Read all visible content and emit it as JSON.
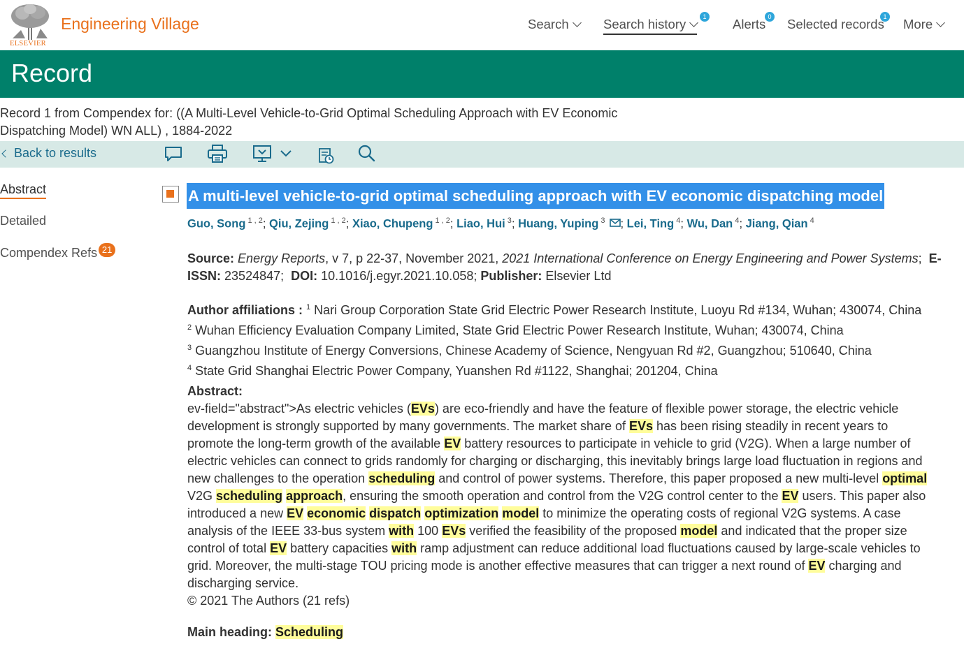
{
  "nav": {
    "brand": "Engineering Village",
    "publisher": "ELSEVIER",
    "search": "Search",
    "search_history": "Search history",
    "search_history_badge": "1",
    "alerts": "Alerts",
    "alerts_badge": "0",
    "selected_records": "Selected records",
    "selected_records_badge": "1",
    "more": "More"
  },
  "header": {
    "title": "Record"
  },
  "query": {
    "line1": "Record 1 from Compendex for: ((A Multi-Level Vehicle-to-Grid Optimal Scheduling Approach with EV Economic",
    "line2": "Dispatching Model) WN ALL) , 1884-2022"
  },
  "toolbar": {
    "back_label": "Back to results",
    "icons": [
      "comment-icon",
      "print-icon",
      "download-icon",
      "save-to-folder-icon",
      "search-icon"
    ]
  },
  "tabs": {
    "abstract": "Abstract",
    "detailed": "Detailed",
    "refs": "Compendex Refs",
    "refs_count": "21"
  },
  "record": {
    "title": "A multi-level vehicle-to-grid optimal scheduling approach with EV economic dispatching model",
    "authors": [
      {
        "name": "Guo, Song",
        "aff": "1 , 2"
      },
      {
        "name": "Qiu, Zejing",
        "aff": "1 , 2"
      },
      {
        "name": "Xiao, Chupeng",
        "aff": "1 , 2"
      },
      {
        "name": "Liao, Hui",
        "aff": "3"
      },
      {
        "name": "Huang, Yuping",
        "aff": "3"
      },
      {
        "name": "Lei, Ting",
        "aff": "4"
      },
      {
        "name": "Wu, Dan",
        "aff": "4"
      },
      {
        "name": "Jiang, Qian",
        "aff": "4"
      }
    ],
    "source": {
      "label": "Source:",
      "journal": "Energy Reports",
      "details": ", v 7, p 22-37, November 2021, ",
      "conference": "2021 International Conference on Energy Engineering and Power Systems",
      "eissn_label": "E-ISSN:",
      "eissn": "23524847",
      "doi_label": "DOI:",
      "doi": "10.1016/j.egyr.2021.10.058",
      "publisher_label": "Publisher:",
      "publisher": "Elsevier Ltd"
    },
    "affiliations": {
      "label": "Author affiliations :",
      "items": [
        {
          "n": "1",
          "text": "Nari Group Corporation State Grid Electric Power Research Institute, Luoyu Rd #134, Wuhan; 430074, China"
        },
        {
          "n": "2",
          "text": "Wuhan Efficiency Evaluation Company Limited, State Grid Electric Power Research Institute, Wuhan; 430074, China"
        },
        {
          "n": "3",
          "text": "Guangzhou Institute of Energy Conversions, Chinese Academy of Science, Nengyuan Rd #2, Guangzhou; 510640, China"
        },
        {
          "n": "4",
          "text": "State Grid Shanghai Electric Power Company, Yuanshen Rd #1122, Shanghai; 201204, China"
        }
      ]
    },
    "abstract": {
      "label": "Abstract:",
      "lines": [
        "ev-field=\"abstract\">As electric vehicles ([[EVs]]) are eco-friendly and have the feature of flexible power storage, the electric vehicle",
        "development is strongly supported by many governments. The market share of [[EVs]] has been rising steadily in recent years to",
        "promote the long-term growth of the available [[EV]] battery resources to participate in vehicle to grid (V2G). When a large number of",
        "electric vehicles can connect to grids randomly for charging or discharging, this inevitably brings large load fluctuation in regions and",
        "new challenges to the operation [[scheduling]] and control of power systems. Therefore, this paper proposed a new multi-level [[optimal]]",
        "V2G [[scheduling]] [[approach]], ensuring the smooth operation and control from the V2G control center to the [[EV]] users. This paper also",
        "introduced a new [[EV]] [[economic]] [[dispatch]] [[optimization]] [[model]] to minimize the operating costs of regional V2G systems. A case",
        "analysis of the IEEE 33-bus system [[with]] 100 [[EVs]] verified the feasibility of the proposed [[model]] and indicated that the proper size",
        "control of total [[EV]] battery capacities [[with]] ramp adjustment can reduce additional load fluctuations caused by large-scale vehicles to",
        "grid. Moreover, the multi-stage TOU pricing mode is another effective measures that can trigger a next round of [[EV]] charging and",
        "discharging service.",
        "© 2021 The Authors (21 refs)"
      ]
    },
    "main_heading": {
      "label": "Main heading:",
      "value": "Scheduling"
    }
  },
  "colors": {
    "brand_orange": "#e9711c",
    "header_green": "#00806a",
    "toolbar_bg": "#d7e9e6",
    "link_blue": "#1a6b8c",
    "highlight": "#fffd9b",
    "selection": "#3390e8"
  }
}
